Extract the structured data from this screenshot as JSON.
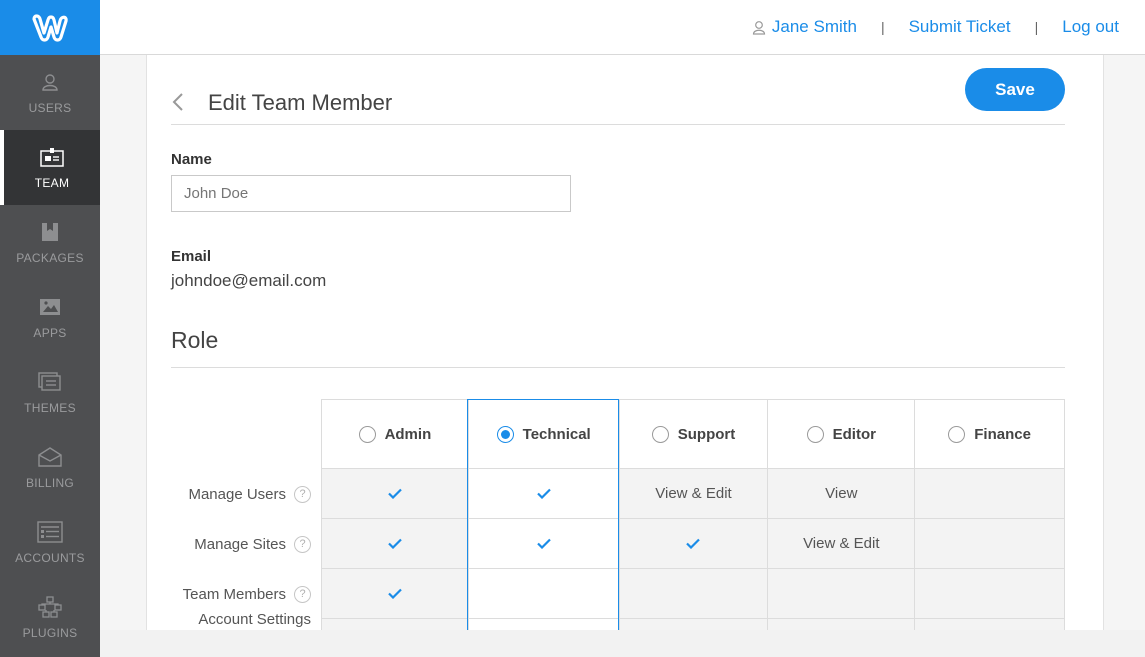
{
  "sidebar": {
    "logo_icon": "weebly-w-logo",
    "items": [
      {
        "label": "USERS",
        "icon": "user-icon",
        "active": false
      },
      {
        "label": "TEAM",
        "icon": "id-badge-icon",
        "active": true
      },
      {
        "label": "PACKAGES",
        "icon": "bookmark-icon",
        "active": false
      },
      {
        "label": "APPS",
        "icon": "image-icon",
        "active": false
      },
      {
        "label": "THEMES",
        "icon": "layers-icon",
        "active": false
      },
      {
        "label": "BILLING",
        "icon": "envelope-icon",
        "active": false
      },
      {
        "label": "ACCOUNTS",
        "icon": "list-card-icon",
        "active": false
      },
      {
        "label": "PLUGINS",
        "icon": "network-icon",
        "active": false
      }
    ]
  },
  "header": {
    "user_name": "Jane Smith",
    "sep": "|",
    "submit_ticket": "Submit Ticket",
    "log_out": "Log out"
  },
  "page": {
    "title": "Edit Team Member",
    "save_label": "Save",
    "name_label": "Name",
    "name_placeholder": "John Doe",
    "email_label": "Email",
    "email_value": "johndoe@email.com",
    "role_title": "Role"
  },
  "roles": [
    {
      "name": "Admin",
      "selected": false
    },
    {
      "name": "Technical",
      "selected": true
    },
    {
      "name": "Support",
      "selected": false
    },
    {
      "name": "Editor",
      "selected": false
    },
    {
      "name": "Finance",
      "selected": false
    }
  ],
  "permissions": [
    {
      "label": "Manage Users",
      "cells": [
        "check",
        "check",
        "View & Edit",
        "View",
        ""
      ]
    },
    {
      "label": "Manage Sites",
      "cells": [
        "check",
        "check",
        "check",
        "View & Edit",
        ""
      ]
    },
    {
      "label": "Team Members",
      "cells": [
        "check",
        "",
        "",
        "",
        ""
      ]
    },
    {
      "label": "Account Settings",
      "cells": [
        "",
        "",
        "",
        "",
        ""
      ]
    }
  ],
  "help_glyph": "?",
  "colors": {
    "accent": "#1a8ce8",
    "sidebar": "#4e4f51",
    "sidebar_active": "#333436"
  }
}
